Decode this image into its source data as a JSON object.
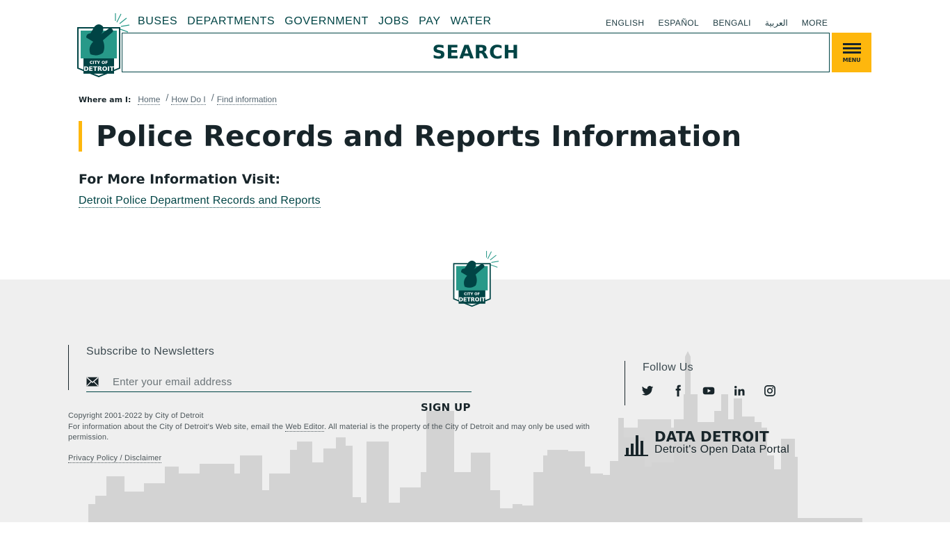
{
  "header": {
    "logo_text": [
      "CITY OF",
      "DETROIT"
    ],
    "nav": [
      "BUSES",
      "DEPARTMENTS",
      "GOVERNMENT",
      "JOBS",
      "PAY",
      "WATER"
    ],
    "languages": [
      "ENGLISH",
      "ESPAÑOL",
      "BENGALI",
      "العربية",
      "MORE"
    ],
    "search_label": "SEARCH",
    "menu_label": "MENU"
  },
  "breadcrumb": {
    "label": "Where am I:",
    "items": [
      "Home",
      "How Do I",
      "Find information"
    ]
  },
  "page": {
    "title": "Police Records and Reports Information",
    "more_heading": "For More Information Visit:",
    "more_link": "Detroit Police Department Records and Reports"
  },
  "footer": {
    "subscribe_title": "Subscribe to Newsletters",
    "email_placeholder": "Enter your email address",
    "signup_label": "SIGN UP",
    "copyright": "Copyright 2001-2022 by City of Detroit",
    "info_before": "For information about the City of Detroit's Web site, email the ",
    "info_link": "Web Editor",
    "info_after": ". All material is the property of the City of Detroit and may only be used with permission.",
    "privacy": "Privacy Policy / Disclaimer",
    "follow_title": "Follow Us",
    "social": [
      "twitter-icon",
      "facebook-icon",
      "youtube-icon",
      "linkedin-icon",
      "instagram-icon"
    ],
    "data_title": "DATA DETROIT",
    "data_sub": "Detroit's Open Data Portal"
  },
  "colors": {
    "brand_green": "#004445",
    "logo_teal": "#279989",
    "accent_yellow": "#feb70d",
    "text_dark": "#18252a",
    "footer_bg": "#efefef",
    "skyline": "#d3d3d3"
  }
}
